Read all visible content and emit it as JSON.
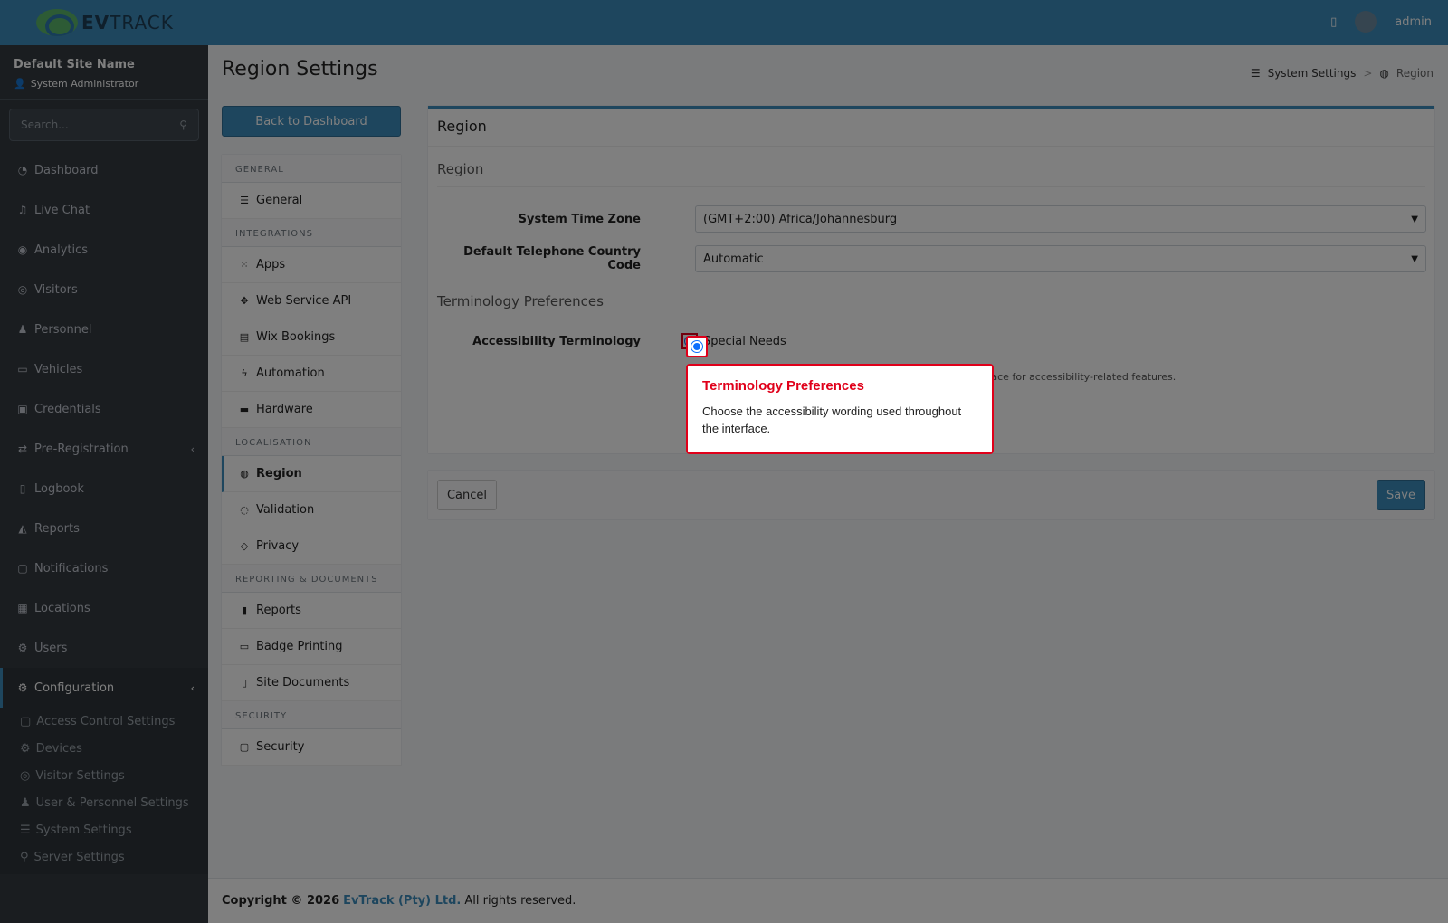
{
  "brand": {
    "name_bold": "EV",
    "name_rest": "TRACK"
  },
  "topbar": {
    "user": "admin"
  },
  "sidebar": {
    "site_name": "Default Site Name",
    "role": "System Administrator",
    "search_placeholder": "Search...",
    "items": [
      {
        "label": "Dashboard",
        "icon": "gauge-icon"
      },
      {
        "label": "Live Chat",
        "icon": "headset-icon"
      },
      {
        "label": "Analytics",
        "icon": "circle-icon"
      },
      {
        "label": "Visitors",
        "icon": "eye-icon"
      },
      {
        "label": "Personnel",
        "icon": "user-tie-icon"
      },
      {
        "label": "Vehicles",
        "icon": "car-icon"
      },
      {
        "label": "Credentials",
        "icon": "id-card-icon"
      },
      {
        "label": "Pre-Registration",
        "icon": "arrows-icon"
      },
      {
        "label": "Logbook",
        "icon": "book-icon"
      },
      {
        "label": "Reports",
        "icon": "chart-area-icon"
      },
      {
        "label": "Notifications",
        "icon": "comments-icon"
      },
      {
        "label": "Locations",
        "icon": "building-icon"
      },
      {
        "label": "Users",
        "icon": "users-cog-icon"
      },
      {
        "label": "Configuration",
        "icon": "cog-icon"
      }
    ],
    "sub_items": [
      {
        "label": "Access Control Settings",
        "icon": "lock-icon"
      },
      {
        "label": "Devices",
        "icon": "devices-icon"
      },
      {
        "label": "Visitor Settings",
        "icon": "eye-icon"
      },
      {
        "label": "User & Personnel Settings",
        "icon": "users-icon"
      },
      {
        "label": "System Settings",
        "icon": "sliders-icon"
      },
      {
        "label": "Server Settings",
        "icon": "server-icon"
      }
    ]
  },
  "page": {
    "title": "Region Settings",
    "breadcrumb": [
      "System Settings",
      "Region"
    ],
    "back_button": "Back to Dashboard"
  },
  "settings_menu": {
    "groups": [
      {
        "header": "GENERAL",
        "items": [
          {
            "label": "General",
            "icon": "list-icon"
          }
        ]
      },
      {
        "header": "INTEGRATIONS",
        "items": [
          {
            "label": "Apps",
            "icon": "grid-icon"
          },
          {
            "label": "Web Service API",
            "icon": "api-icon"
          },
          {
            "label": "Wix Bookings",
            "icon": "calendar-icon"
          },
          {
            "label": "Automation",
            "icon": "bolt-icon"
          },
          {
            "label": "Hardware",
            "icon": "hardware-icon"
          }
        ]
      },
      {
        "header": "LOCALISATION",
        "items": [
          {
            "label": "Region",
            "icon": "globe-icon"
          },
          {
            "label": "Validation",
            "icon": "check-circle-icon"
          },
          {
            "label": "Privacy",
            "icon": "shield-icon"
          }
        ]
      },
      {
        "header": "REPORTING & DOCUMENTS",
        "items": [
          {
            "label": "Reports",
            "icon": "bar-chart-icon"
          },
          {
            "label": "Badge Printing",
            "icon": "printer-icon"
          },
          {
            "label": "Site Documents",
            "icon": "file-icon"
          }
        ]
      },
      {
        "header": "SECURITY",
        "items": [
          {
            "label": "Security",
            "icon": "lock-icon"
          }
        ]
      }
    ]
  },
  "form": {
    "card_title": "Region",
    "section_region": "Region",
    "time_zone_label": "System Time Zone",
    "time_zone_value": "(GMT+2:00) Africa/Johannesburg",
    "country_code_label": "Default Telephone Country Code",
    "country_code_value": "Automatic",
    "section_terminology": "Terminology Preferences",
    "accessibility_label": "Accessibility Terminology",
    "accessibility_option": "Special Needs",
    "help_text": "rface for accessibility-related features.",
    "cancel": "Cancel",
    "save": "Save"
  },
  "footer": {
    "copyright": "Copyright © 2026",
    "company": "EvTrack (Pty) Ltd.",
    "rights": "All rights reserved."
  },
  "tooltip": {
    "title": "Terminology Preferences",
    "body": "Choose the accessibility wording used throughout the interface."
  }
}
